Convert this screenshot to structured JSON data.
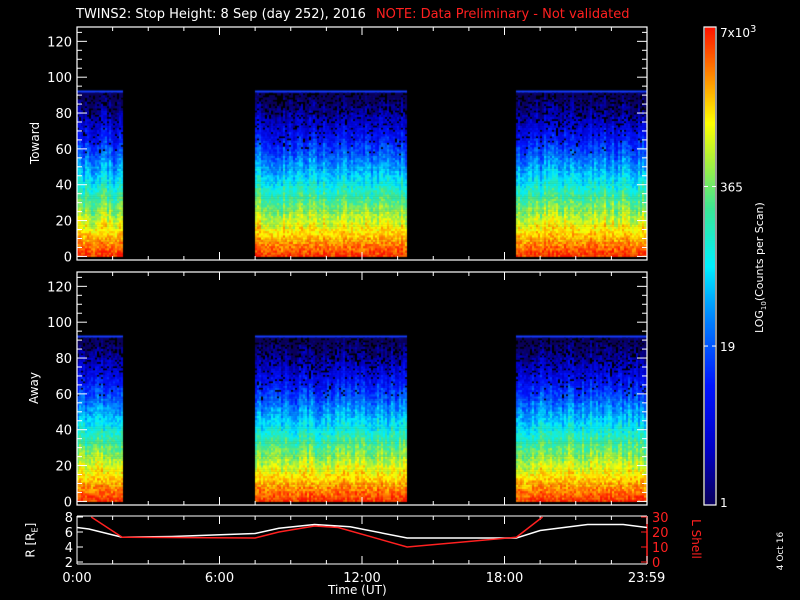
{
  "title": {
    "main": "TWINS2: Stop Height:  8 Sep (day 252), 2016",
    "note": "NOTE: Data Preliminary - Not validated",
    "note_color": "#ff2020"
  },
  "date_stamp": "4 Oct 16",
  "chart_data": [
    {
      "type": "heatmap",
      "panel": "Toward",
      "ylabel": "Toward",
      "ylim": [
        -2,
        128
      ],
      "yticks": [
        0,
        20,
        40,
        60,
        80,
        100,
        120
      ],
      "x_hours_range": [
        0,
        24
      ],
      "data_intervals_hours": [
        [
          0.0,
          1.9
        ],
        [
          7.5,
          13.9
        ],
        [
          18.5,
          24.0
        ]
      ],
      "max_stop_height": 92,
      "description_profile": "counts highest (~7000) at stop height 0-10, decreasing to ~1 near 90"
    },
    {
      "type": "heatmap",
      "panel": "Away",
      "ylabel": "Away",
      "ylim": [
        -2,
        128
      ],
      "yticks": [
        0,
        20,
        40,
        60,
        80,
        100,
        120
      ],
      "x_hours_range": [
        0,
        24
      ],
      "data_intervals_hours": [
        [
          0.0,
          1.9
        ],
        [
          7.5,
          13.9
        ],
        [
          18.5,
          24.0
        ]
      ],
      "max_stop_height": 92
    },
    {
      "type": "line",
      "xlabel": "Time (UT)",
      "xticks": [
        {
          "h": 0,
          "label": "0:00"
        },
        {
          "h": 6,
          "label": "6:00"
        },
        {
          "h": 12,
          "label": "12:00"
        },
        {
          "h": 18,
          "label": "18:00"
        },
        {
          "h": 23.983,
          "label": "23:59"
        }
      ],
      "left_axis": {
        "label": "R [R",
        "label_sub": "E",
        "label_end": "]",
        "ylim": [
          2,
          8
        ],
        "ticks": [
          2,
          4,
          6,
          8
        ],
        "color": "#ffffff"
      },
      "right_axis": {
        "label": "L Shell",
        "ylim": [
          0,
          30
        ],
        "ticks": [
          0,
          10,
          20,
          30
        ],
        "color": "#ff2020"
      },
      "series": [
        {
          "name": "R",
          "axis": "left",
          "color": "#ffffff",
          "x": [
            0,
            0.5,
            1.9,
            4,
            7.5,
            8.5,
            10,
            11.5,
            13.9,
            16,
            18.5,
            19.5,
            21.5,
            23,
            24
          ],
          "y": [
            6.6,
            6.4,
            5.3,
            5.4,
            5.8,
            6.5,
            7.0,
            6.7,
            5.2,
            5.2,
            5.2,
            6.2,
            7.0,
            7.0,
            6.6
          ]
        },
        {
          "name": "L Shell",
          "axis": "right",
          "color": "#ff2020",
          "x": [
            0.6,
            1.9,
            7.5,
            8.5,
            10,
            11,
            13.9,
            18.5,
            19.6
          ],
          "y": [
            30,
            16.5,
            16,
            20,
            24,
            23,
            10,
            16.5,
            30
          ]
        }
      ]
    },
    {
      "type": "colorbar",
      "label": "LOG",
      "label_sub": "10",
      "label_end": "(Counts per Scan)",
      "range": [
        1,
        7000
      ],
      "scale": "log",
      "ticks": [
        {
          "v": 1,
          "label": "1"
        },
        {
          "v": 19,
          "label": "19"
        },
        {
          "v": 365,
          "label": "365"
        },
        {
          "v": 7000,
          "label": "7x10",
          "sup": "3"
        }
      ]
    }
  ]
}
